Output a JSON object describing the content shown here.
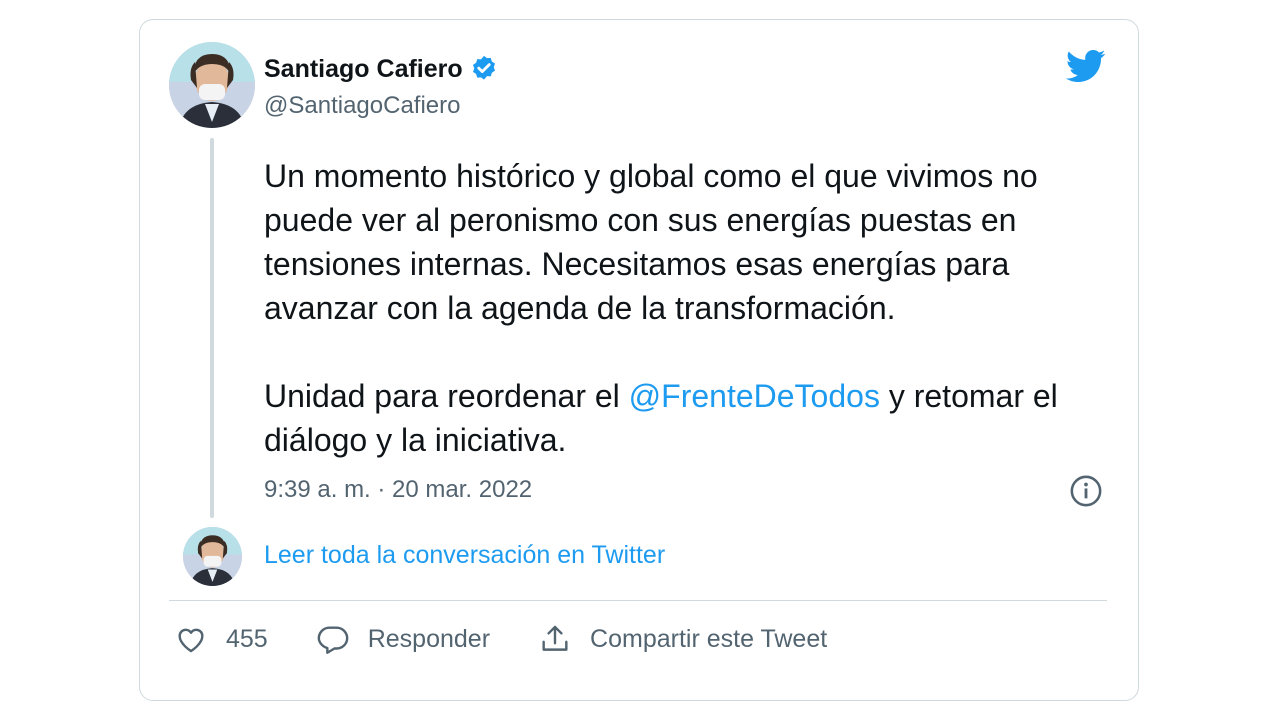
{
  "author": {
    "display_name": "Santiago Cafiero",
    "handle": "@SantiagoCafiero",
    "verified": true,
    "avatar": "profile-photo"
  },
  "tweet": {
    "paragraph1": "Un momento histórico y global como el que vivimos no puede ver al peronismo con sus energías puestas en tensiones internas. Necesitamos esas energías para avanzar con la agenda de la transformación.",
    "paragraph2_before": "Unidad para reordenar el ",
    "mention": "@FrenteDeTodos",
    "paragraph2_after": " y retomar el diálogo y la iniciativa.",
    "timestamp": "9:39 a. m. · 20 mar. 2022"
  },
  "read_conversation_label": "Leer toda la conversación en Twitter",
  "actions": {
    "like_count": "455",
    "reply_label": "Responder",
    "share_label": "Compartir este Tweet"
  },
  "icons": {
    "brand": "twitter-bird-icon",
    "verified": "verified-badge-icon",
    "info": "info-icon",
    "like": "heart-icon",
    "reply": "reply-bubble-icon",
    "share": "share-icon"
  },
  "colors": {
    "accent": "#1d9bf0",
    "text": "#0f1419",
    "secondary": "#536471",
    "border": "#cfd9de"
  }
}
